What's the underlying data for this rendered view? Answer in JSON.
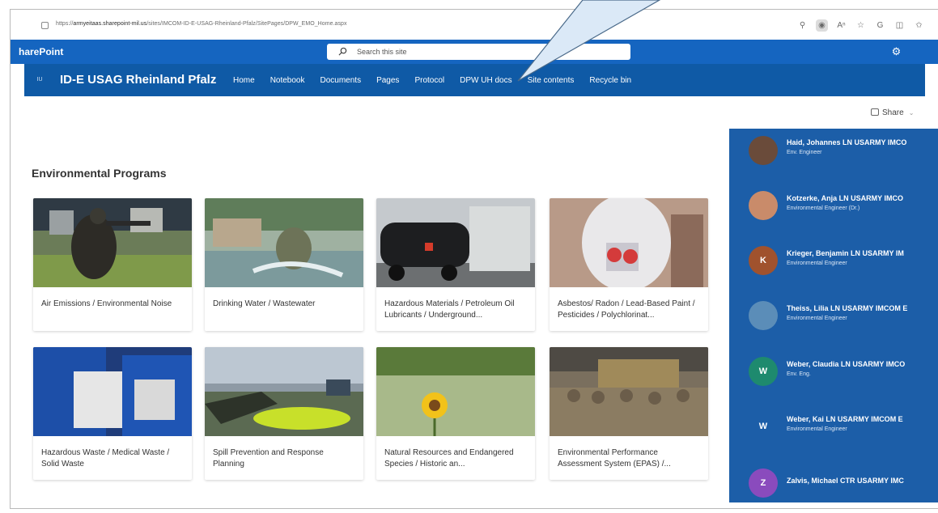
{
  "browser": {
    "url_prefix": "https://",
    "url_host": "armyeitaas.sharepoint-mil.us",
    "url_path": "/sites/IMCOM-ID-E-USAG-Rheinland-Pfalz/SitePages/DPW_EMO_Home.aspx",
    "icons": [
      "zoom-icon",
      "tracking-icon",
      "read-aloud-icon",
      "favorite-icon",
      "browser-profile-icon",
      "split-screen-icon",
      "favorites-bar-icon"
    ]
  },
  "suite": {
    "brand": "harePoint",
    "search_placeholder": "Search this site"
  },
  "site": {
    "logo": "IU",
    "name": "ID-E USAG Rheinland Pfalz",
    "nav": [
      "Home",
      "Notebook",
      "Documents",
      "Pages",
      "Protocol",
      "DPW UH docs",
      "Site contents",
      "Recycle bin"
    ]
  },
  "share_label": "Share",
  "section_title": "Environmental Programs",
  "cards": [
    {
      "caption": "Air Emissions / Environmental Noise"
    },
    {
      "caption": "Drinking Water / Wastewater"
    },
    {
      "caption": "Hazardous Materials / Petroleum Oil Lubricants / Underground..."
    },
    {
      "caption": "Asbestos/ Radon / Lead-Based Paint / Pesticides / Polychlorinat..."
    },
    {
      "caption": "Hazardous Waste / Medical Waste / Solid Waste"
    },
    {
      "caption": "Spill Prevention and Response Planning"
    },
    {
      "caption": "Natural Resources and Endangered Species / Historic an..."
    },
    {
      "caption": "Environmental Performance Assessment System (EPAS) /..."
    }
  ],
  "people": [
    {
      "name": "Haid, Johannes LN USARMY IMCO",
      "title": "Env. Engineer",
      "initial": "",
      "color": "#6a4b3a"
    },
    {
      "name": "Kotzerke, Anja LN USARMY IMCO",
      "title": "Environmental Engineer (Dr.)",
      "initial": "",
      "color": "#c98b6a"
    },
    {
      "name": "Krieger, Benjamin LN USARMY IM",
      "title": "Environmental Engineer",
      "initial": "K",
      "color": "#a0522d"
    },
    {
      "name": "Theiss, Lilia LN USARMY IMCOM E",
      "title": "Environmental Engineer",
      "initial": "",
      "color": "#5b8db8"
    },
    {
      "name": "Weber, Claudia LN USARMY IMCO",
      "title": "Env. Eng.",
      "initial": "W",
      "color": "#1e8a6e"
    },
    {
      "name": "Weber, Kai LN USARMY IMCOM E",
      "title": "Environmental Engineer",
      "initial": "W",
      "color": "#1c5ea8"
    },
    {
      "name": "Zalvis, Michael CTR USARMY IMC",
      "title": "",
      "initial": "Z",
      "color": "#8a4bbd"
    }
  ],
  "colors": {
    "suite_bar": "#1565c0",
    "site_bar": "#0f5aa6",
    "people_panel": "#1c5ea8"
  }
}
